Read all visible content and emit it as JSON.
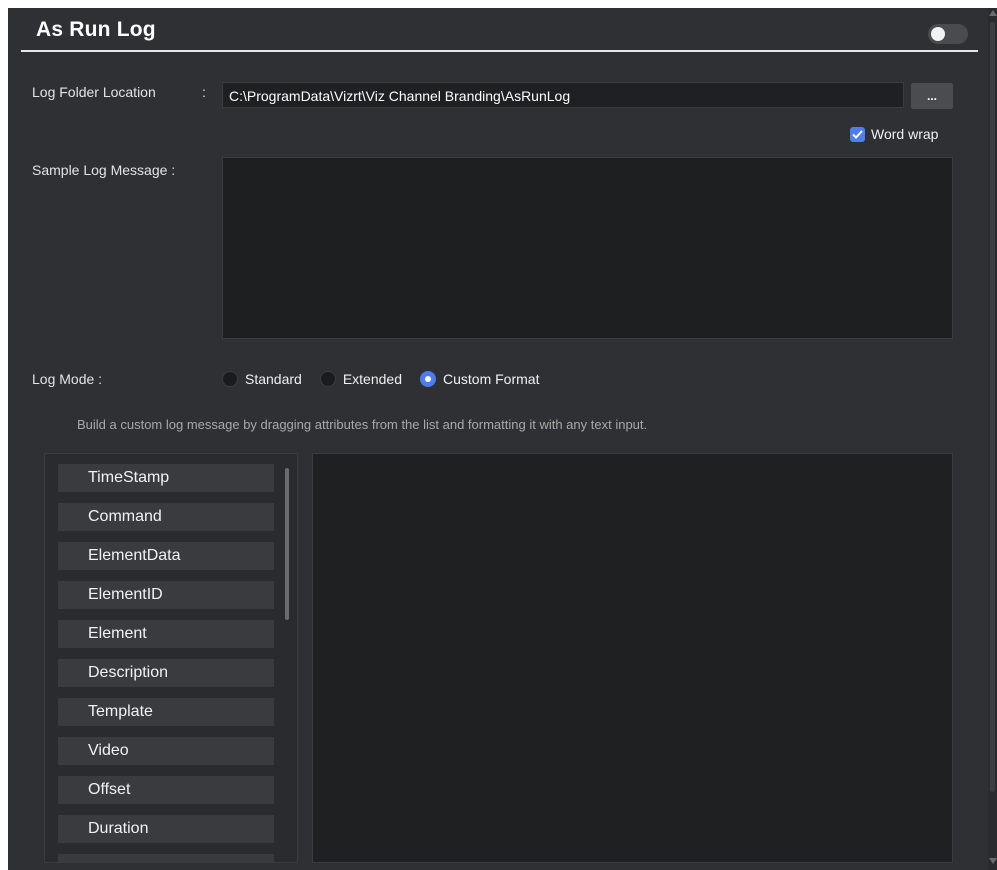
{
  "window": {
    "title": "As Run Log"
  },
  "log_folder": {
    "label": "Log Folder Location",
    "separator": ":",
    "value": "C:\\ProgramData\\Vizrt\\Viz Channel Branding\\AsRunLog",
    "browse_label": "..."
  },
  "word_wrap": {
    "label": "Word wrap",
    "checked": true
  },
  "sample_log": {
    "label": "Sample Log Message :",
    "value": ""
  },
  "log_mode": {
    "label": "Log Mode :",
    "options": [
      {
        "label": "Standard",
        "selected": false
      },
      {
        "label": "Extended",
        "selected": false
      },
      {
        "label": "Custom Format",
        "selected": true
      }
    ]
  },
  "hint": "Build a custom log message by dragging attributes from the list and formatting it with any text input.",
  "attributes": [
    "TimeStamp",
    "Command",
    "ElementData",
    "ElementID",
    "Element",
    "Description",
    "Template",
    "Video",
    "Offset",
    "Duration"
  ],
  "colors": {
    "background": "#2f3033",
    "accent": "#4d7df0",
    "input_bg": "#1f2022"
  }
}
